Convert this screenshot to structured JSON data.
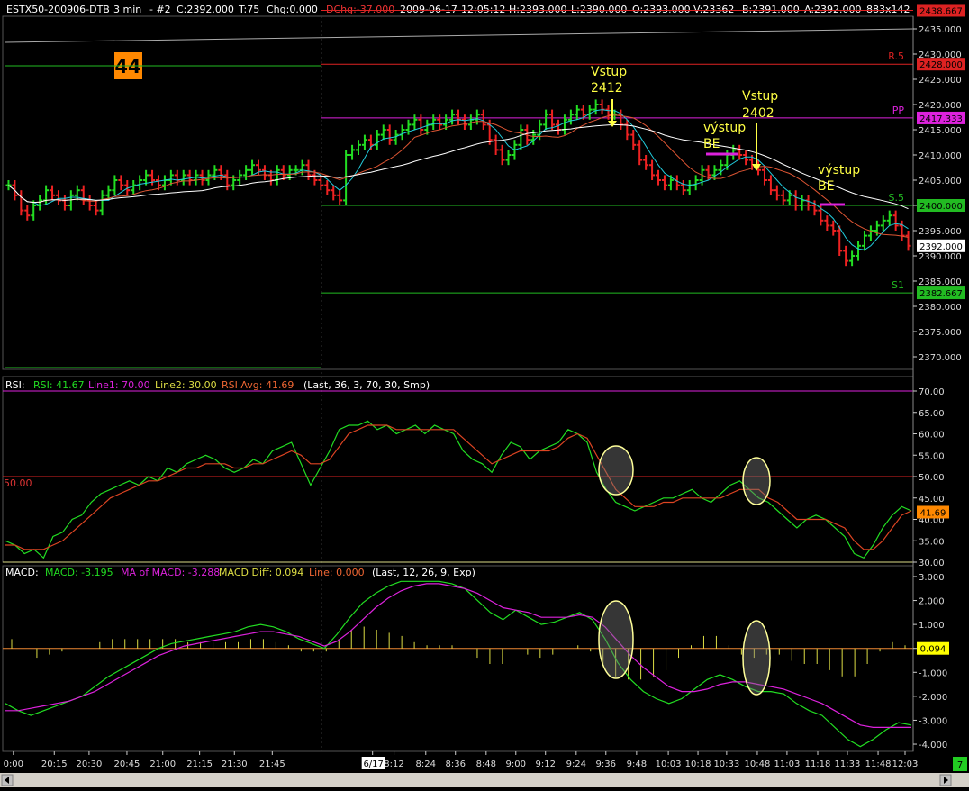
{
  "header": {
    "symbol": "ESTX50-200906-DTB",
    "interval": "3 min",
    "chart_no": "-  #2",
    "close": "C:2392.000",
    "ticks": "T:75",
    "chg": "Chg:0.000",
    "dchg": "DChg:-37.000",
    "date": "2009-06-17",
    "time": "12:05:12",
    "high": "H:2393.000",
    "low": "L:2390.000",
    "open": "O:2393.000",
    "volume": "V:23362",
    "bid": "B:2391.000",
    "ask": "A:2392.000",
    "size": "883x142"
  },
  "badge": "44",
  "colors": {
    "background": "#000000",
    "up_bar": "#22dd22",
    "down_bar": "#ee2222",
    "ma_fast": "#22ccdd",
    "ma_mid": "#dd5533",
    "ma_slow": "#ffffff",
    "rsi": "#22dd22",
    "rsi_avg": "#dd4422",
    "macd": "#22dd22",
    "macd_ma": "#dd22dd",
    "hist": "#dddd44",
    "pivot": "#dd22dd",
    "resistance": "#dd2222",
    "support": "#22bb22"
  },
  "indicators": {
    "rsi": {
      "label": "RSI:",
      "value": "RSI: 41.67",
      "line1": "Line1: 70.00",
      "line2": "Line2: 30.00",
      "avg": "RSI Avg: 41.69",
      "params": "(Last, 36, 3, 70, 30, Smp)",
      "level50": "50.00"
    },
    "macd": {
      "label": "MACD:",
      "value": "MACD: -3.195",
      "ma": "MA of MACD: -3.288",
      "diff": "MACD Diff: 0.094",
      "line": "Line: 0.000",
      "params": "(Last, 12, 26, 9, Exp)"
    }
  },
  "annotations": [
    {
      "id": "entry1",
      "lines": [
        "Vstup",
        "2412"
      ],
      "color": "#ffff44"
    },
    {
      "id": "exit1",
      "lines": [
        "výstup",
        "BE"
      ],
      "color": "#ffff44"
    },
    {
      "id": "entry2",
      "lines": [
        "Vstup",
        "2402"
      ],
      "color": "#ffff44"
    },
    {
      "id": "exit2",
      "lines": [
        "výstup",
        "BE"
      ],
      "color": "#ffff44"
    }
  ],
  "levels": [
    {
      "name": "R1",
      "label": "",
      "value": 2438.667,
      "tag": "2438.667",
      "color": "#dd2222"
    },
    {
      "name": "R.5",
      "label": "R.5",
      "value": 2428.0,
      "tag": "2428.000",
      "color": "#dd2222"
    },
    {
      "name": "PP",
      "label": "PP",
      "value": 2417.333,
      "tag": "2417.333",
      "color": "#dd22dd"
    },
    {
      "name": "S.5",
      "label": "S.5",
      "value": 2400.0,
      "tag": "2400.000",
      "color": "#22bb22"
    },
    {
      "name": "S1",
      "label": "S1",
      "value": 2382.667,
      "tag": "2382.667",
      "color": "#22bb22"
    }
  ],
  "last_price_tag": "2392.000",
  "rsi_last_tag": "41.69",
  "macd_last_tag": "0.094",
  "corner_tag": "7",
  "chart_data": [
    {
      "type": "candlestick",
      "title": "ESTX50-200906-DTB 3 min",
      "ylim": [
        2367.5,
        2437.5
      ],
      "yticks": [
        "2435.000",
        "2430.000",
        "2425.000",
        "2420.000",
        "2415.000",
        "2410.000",
        "2405.000",
        "2400.000",
        "2395.000",
        "2390.000",
        "2385.000",
        "2380.000",
        "2375.000",
        "2370.000"
      ],
      "ytick_values": [
        2435,
        2430,
        2425,
        2420,
        2415,
        2410,
        2405,
        2400,
        2395,
        2390,
        2385,
        2380,
        2375,
        2370
      ],
      "x_ticks": [
        "0:00",
        "20:15",
        "20:30",
        "20:45",
        "21:00",
        "21:15",
        "21:30",
        "21:45",
        "6/17",
        "8:12",
        "8:24",
        "8:36",
        "8:48",
        "9:00",
        "9:12",
        "9:24",
        "9:36",
        "9:48",
        "10:03",
        "10:18",
        "10:33",
        "10:48",
        "11:03",
        "11:18",
        "11:33",
        "11:48",
        "12:03"
      ],
      "close": [
        2404,
        2402,
        2399,
        2398,
        2400,
        2401,
        2403,
        2402,
        2401,
        2400,
        2402,
        2403,
        2401,
        2400,
        2399,
        2402,
        2403,
        2405,
        2404,
        2403,
        2404,
        2405,
        2406,
        2405,
        2404,
        2405,
        2406,
        2405,
        2406,
        2405,
        2406,
        2405,
        2406,
        2407,
        2406,
        2404,
        2405,
        2406,
        2407,
        2408,
        2407,
        2406,
        2405,
        2407,
        2406,
        2407,
        2407,
        2408,
        2406,
        2405,
        2404,
        2403,
        2402,
        2401,
        2410,
        2411,
        2412,
        2413,
        2412,
        2414,
        2415,
        2413,
        2414,
        2415,
        2416,
        2417,
        2415,
        2416,
        2417,
        2416,
        2417,
        2418,
        2417,
        2416,
        2417,
        2418,
        2416,
        2413,
        2411,
        2409,
        2410,
        2412,
        2415,
        2413,
        2414,
        2416,
        2418,
        2416,
        2415,
        2417,
        2418,
        2419,
        2418,
        2419,
        2420,
        2419,
        2418,
        2418,
        2416,
        2414,
        2412,
        2409,
        2408,
        2406,
        2405,
        2404,
        2405,
        2404,
        2403,
        2404,
        2405,
        2407,
        2406,
        2407,
        2408,
        2410,
        2411,
        2410,
        2409,
        2408,
        2407,
        2405,
        2403,
        2402,
        2401,
        2402,
        2400,
        2401,
        2400,
        2399,
        2397,
        2396,
        2395,
        2391,
        2389,
        2390,
        2392,
        2394,
        2395,
        2396,
        2397,
        2398,
        2396,
        2394,
        2392
      ],
      "x_label_count": 27
    },
    {
      "type": "line",
      "title": "RSI",
      "ylim": [
        30,
        70
      ],
      "yticks": [
        "70.00",
        "65.00",
        "60.00",
        "55.00",
        "50.00",
        "45.00",
        "40.00",
        "35.00",
        "30.00"
      ],
      "ytick_values": [
        70,
        65,
        60,
        55,
        50,
        45,
        40,
        35,
        30
      ],
      "series": [
        {
          "name": "RSI",
          "values": [
            35,
            34,
            32,
            33,
            31,
            36,
            37,
            40,
            41,
            44,
            46,
            47,
            48,
            49,
            48,
            50,
            49,
            52,
            51,
            53,
            54,
            55,
            54,
            52,
            51,
            52,
            54,
            53,
            56,
            57,
            58,
            53,
            48,
            52,
            56,
            61,
            62,
            62,
            63,
            61,
            62,
            60,
            61,
            62,
            60,
            62,
            61,
            60,
            56,
            54,
            53,
            51,
            55,
            58,
            57,
            54,
            56,
            57,
            58,
            61,
            60,
            58,
            51,
            47,
            44,
            43,
            42,
            43,
            44,
            45,
            45,
            46,
            47,
            45,
            44,
            46,
            48,
            49,
            47,
            45,
            44,
            42,
            40,
            38,
            40,
            41,
            40,
            38,
            36,
            32,
            31,
            34,
            38,
            41,
            43,
            42
          ]
        },
        {
          "name": "RSI Avg",
          "values": [
            34,
            34,
            33,
            33,
            33,
            34,
            35,
            37,
            39,
            41,
            43,
            45,
            46,
            47,
            48,
            49,
            49,
            50,
            51,
            52,
            52,
            53,
            53,
            53,
            52,
            52,
            53,
            53,
            54,
            55,
            56,
            55,
            53,
            53,
            54,
            57,
            60,
            61,
            62,
            62,
            62,
            61,
            61,
            61,
            61,
            61,
            61,
            61,
            59,
            57,
            55,
            53,
            54,
            55,
            56,
            56,
            56,
            56,
            57,
            59,
            60,
            59,
            55,
            51,
            47,
            45,
            43,
            43,
            43,
            44,
            44,
            45,
            45,
            45,
            45,
            45,
            46,
            47,
            47,
            47,
            45,
            44,
            42,
            40,
            40,
            40,
            40,
            39,
            38,
            35,
            33,
            33,
            35,
            38,
            41,
            42
          ]
        }
      ],
      "level_lines": [
        70,
        50,
        30
      ]
    },
    {
      "type": "line",
      "title": "MACD",
      "ylim": [
        -4.3,
        3.3
      ],
      "yticks": [
        "3.000",
        "2.000",
        "1.000",
        "0.000",
        "-1.000",
        "-2.000",
        "-3.000",
        "-4.000"
      ],
      "ytick_values": [
        3,
        2,
        1,
        0,
        -1,
        -2,
        -3,
        -4
      ],
      "series": [
        {
          "name": "MACD",
          "values": [
            -2.3,
            -2.6,
            -2.8,
            -2.6,
            -2.4,
            -2.2,
            -2.0,
            -1.6,
            -1.2,
            -0.9,
            -0.6,
            -0.3,
            0.0,
            0.2,
            0.3,
            0.4,
            0.5,
            0.6,
            0.7,
            0.9,
            1.0,
            0.9,
            0.7,
            0.4,
            0.2,
            0.0,
            0.6,
            1.3,
            1.9,
            2.3,
            2.6,
            2.8,
            2.8,
            2.8,
            2.8,
            2.7,
            2.5,
            2.0,
            1.5,
            1.2,
            1.6,
            1.3,
            1.0,
            1.1,
            1.3,
            1.5,
            1.2,
            0.4,
            -0.6,
            -1.3,
            -1.8,
            -2.1,
            -2.3,
            -2.1,
            -1.7,
            -1.3,
            -1.1,
            -1.3,
            -1.6,
            -1.8,
            -1.8,
            -1.9,
            -2.3,
            -2.6,
            -2.8,
            -3.3,
            -3.8,
            -4.1,
            -3.8,
            -3.4,
            -3.1,
            -3.2
          ]
        },
        {
          "name": "MA of MACD",
          "values": [
            -2.6,
            -2.6,
            -2.5,
            -2.4,
            -2.3,
            -2.2,
            -2.0,
            -1.8,
            -1.5,
            -1.2,
            -0.9,
            -0.6,
            -0.3,
            -0.1,
            0.1,
            0.2,
            0.3,
            0.4,
            0.5,
            0.6,
            0.7,
            0.7,
            0.6,
            0.5,
            0.3,
            0.1,
            0.3,
            0.7,
            1.2,
            1.7,
            2.1,
            2.4,
            2.6,
            2.7,
            2.7,
            2.6,
            2.5,
            2.3,
            2.0,
            1.7,
            1.6,
            1.5,
            1.3,
            1.3,
            1.3,
            1.4,
            1.3,
            0.9,
            0.3,
            -0.3,
            -0.8,
            -1.2,
            -1.6,
            -1.8,
            -1.8,
            -1.7,
            -1.5,
            -1.4,
            -1.4,
            -1.5,
            -1.6,
            -1.7,
            -1.9,
            -2.1,
            -2.3,
            -2.6,
            -2.9,
            -3.2,
            -3.3,
            -3.3,
            -3.3,
            -3.3
          ]
        },
        {
          "name": "MACD Diff",
          "values": [
            0.3,
            0.0,
            -0.3,
            -0.2,
            -0.1,
            0.0,
            0.0,
            0.2,
            0.3,
            0.3,
            0.3,
            0.3,
            0.3,
            0.3,
            0.2,
            0.2,
            0.2,
            0.2,
            0.2,
            0.3,
            0.3,
            0.2,
            0.1,
            -0.1,
            -0.1,
            -0.1,
            0.3,
            0.6,
            0.7,
            0.6,
            0.5,
            0.4,
            0.2,
            0.1,
            0.1,
            0.1,
            0.0,
            -0.3,
            -0.5,
            -0.5,
            0.0,
            -0.2,
            -0.3,
            -0.2,
            0.0,
            0.1,
            -0.1,
            -0.5,
            -0.9,
            -1.0,
            -1.0,
            -0.9,
            -0.7,
            -0.3,
            0.1,
            0.4,
            0.4,
            0.1,
            -0.2,
            -0.3,
            -0.2,
            -0.2,
            -0.4,
            -0.5,
            -0.5,
            -0.7,
            -0.9,
            -0.9,
            -0.5,
            -0.1,
            0.2,
            0.1
          ]
        }
      ]
    }
  ]
}
